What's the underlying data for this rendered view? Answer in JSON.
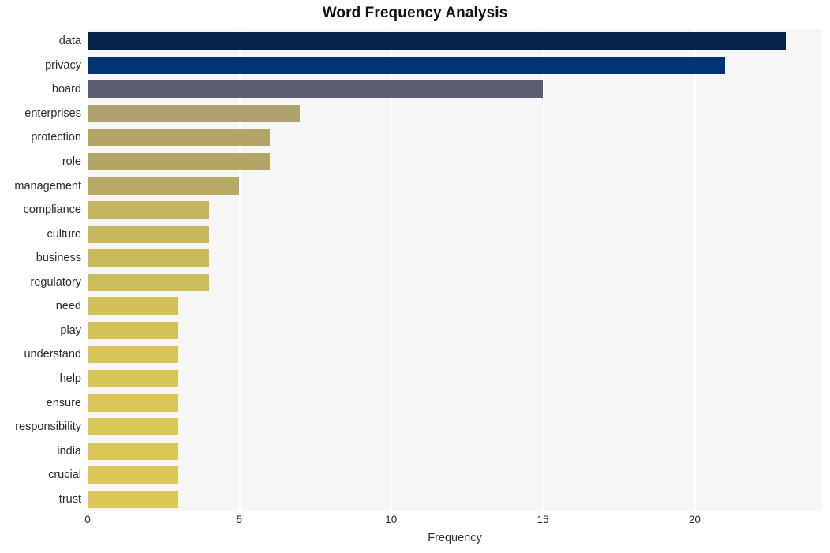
{
  "chart_data": {
    "type": "bar",
    "orientation": "horizontal",
    "title": "Word Frequency Analysis",
    "xlabel": "Frequency",
    "ylabel": "",
    "xlim": [
      0,
      24.2
    ],
    "ylim": [
      0,
      20
    ],
    "grid": "vertical-only",
    "legend": "none",
    "xticks": [
      0,
      5,
      10,
      15,
      20
    ],
    "xtick_labels": [
      "0",
      "5",
      "10",
      "15",
      "20"
    ],
    "categories": [
      "data",
      "privacy",
      "board",
      "enterprises",
      "protection",
      "role",
      "management",
      "compliance",
      "culture",
      "business",
      "regulatory",
      "need",
      "play",
      "understand",
      "help",
      "ensure",
      "responsibility",
      "india",
      "crucial",
      "trust"
    ],
    "values": [
      23,
      21,
      15,
      7,
      6,
      6,
      5,
      4,
      4,
      4,
      4,
      3,
      3,
      3,
      3,
      3,
      3,
      3,
      3,
      3
    ],
    "bar_colors": [
      "#04224c",
      "#023474",
      "#5a5e70",
      "#ada16e",
      "#b3a566",
      "#b3a566",
      "#b8a963",
      "#c4b45e",
      "#c8b85d",
      "#cbba5c",
      "#cdbc5b",
      "#d2c059",
      "#d4c259",
      "#d6c458",
      "#d7c558",
      "#d8c658",
      "#d9c757",
      "#dac757",
      "#dbc857",
      "#dcc857"
    ],
    "plot_background": "#f6f6f6",
    "gridline_color": "#ffffff",
    "figure_background": "#ffffff",
    "text_color": "#2b2b2b",
    "title_color": "#121212"
  }
}
